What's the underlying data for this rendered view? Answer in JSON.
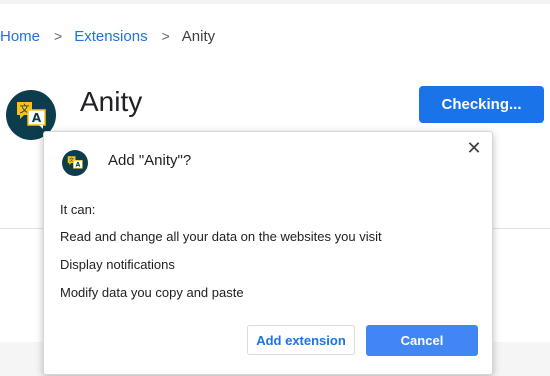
{
  "breadcrumb": {
    "home": "Home",
    "extensions": "Extensions",
    "current": "Anity",
    "separator": ">"
  },
  "extension": {
    "name": "Anity",
    "icon": "translate-icon",
    "status_button": "Checking..."
  },
  "dialog": {
    "title": "Add \"Anity\"?",
    "close_icon": "close-icon",
    "permissions_label": "It can:",
    "permissions": [
      "Read and change all your data on the websites you visit",
      "Display notifications",
      "Modify data you copy and paste"
    ],
    "add_button": "Add extension",
    "cancel_button": "Cancel"
  },
  "colors": {
    "accent": "#1a73e8",
    "cancel_bg": "#4285f4",
    "icon_bg": "#0b3d4c",
    "icon_badge": "#f9c21b"
  }
}
